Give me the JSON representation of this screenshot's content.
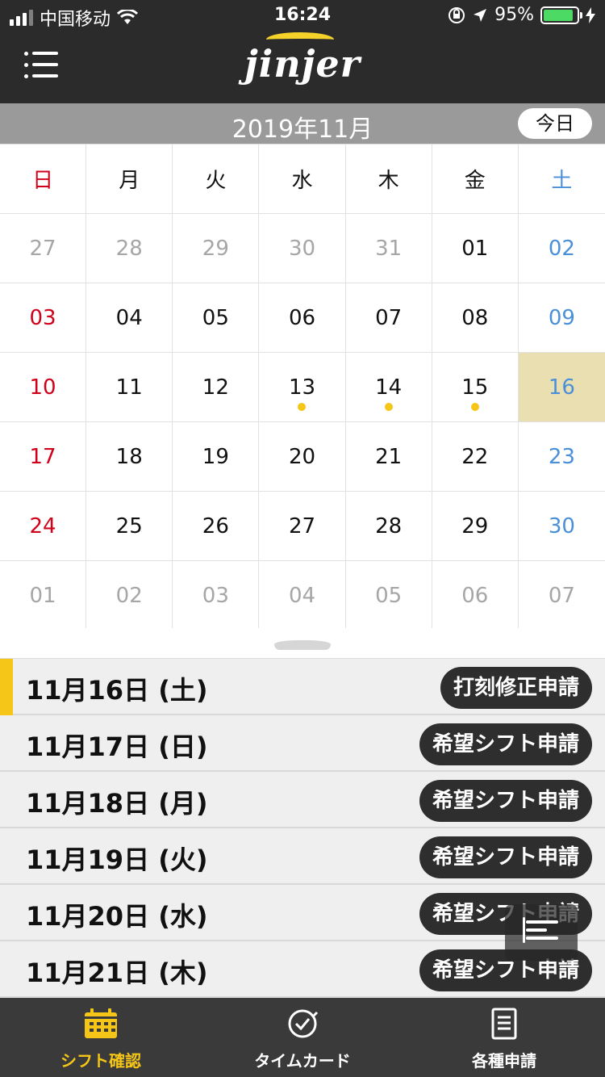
{
  "status_bar": {
    "carrier": "中国移动",
    "time": "16:24",
    "battery": "95%",
    "battery_level": 0.95
  },
  "header": {
    "logo": "jinjer",
    "menu_icon": "hamburger-menu-icon"
  },
  "calendar": {
    "month_title": "2019年11月",
    "today_label": "今日",
    "weekdays": [
      "日",
      "月",
      "火",
      "水",
      "木",
      "金",
      "土"
    ],
    "weeks": [
      [
        "27",
        "28",
        "29",
        "30",
        "31",
        "01",
        "02"
      ],
      [
        "03",
        "04",
        "05",
        "06",
        "07",
        "08",
        "09"
      ],
      [
        "10",
        "11",
        "12",
        "13",
        "14",
        "15",
        "16"
      ],
      [
        "17",
        "18",
        "19",
        "20",
        "21",
        "22",
        "23"
      ],
      [
        "24",
        "25",
        "26",
        "27",
        "28",
        "29",
        "30"
      ],
      [
        "01",
        "02",
        "03",
        "04",
        "05",
        "06",
        "07"
      ]
    ],
    "selected_date": "16",
    "dotted_dates": [
      "13",
      "14",
      "15"
    ],
    "accent_color": "#f5c518",
    "sunday_color": "#d0021b",
    "saturday_color": "#4a90d9"
  },
  "list": [
    {
      "date": "11月16日 (土)",
      "button": "打刻修正申請",
      "active": true
    },
    {
      "date": "11月17日 (日)",
      "button": "希望シフト申請",
      "active": false
    },
    {
      "date": "11月18日 (月)",
      "button": "希望シフト申請",
      "active": false
    },
    {
      "date": "11月19日 (火)",
      "button": "希望シフト申請",
      "active": false
    },
    {
      "date": "11月20日 (水)",
      "button": "希望シフト申請",
      "active": false
    },
    {
      "date": "11月21日 (木)",
      "button": "希望シフト申請",
      "active": false
    }
  ],
  "tabbar": {
    "tabs": [
      {
        "label": "シフト確認",
        "icon": "calendar-icon",
        "active": true
      },
      {
        "label": "タイムカード",
        "icon": "clock-check-icon",
        "active": false
      },
      {
        "label": "各種申請",
        "icon": "document-icon",
        "active": false
      }
    ]
  }
}
